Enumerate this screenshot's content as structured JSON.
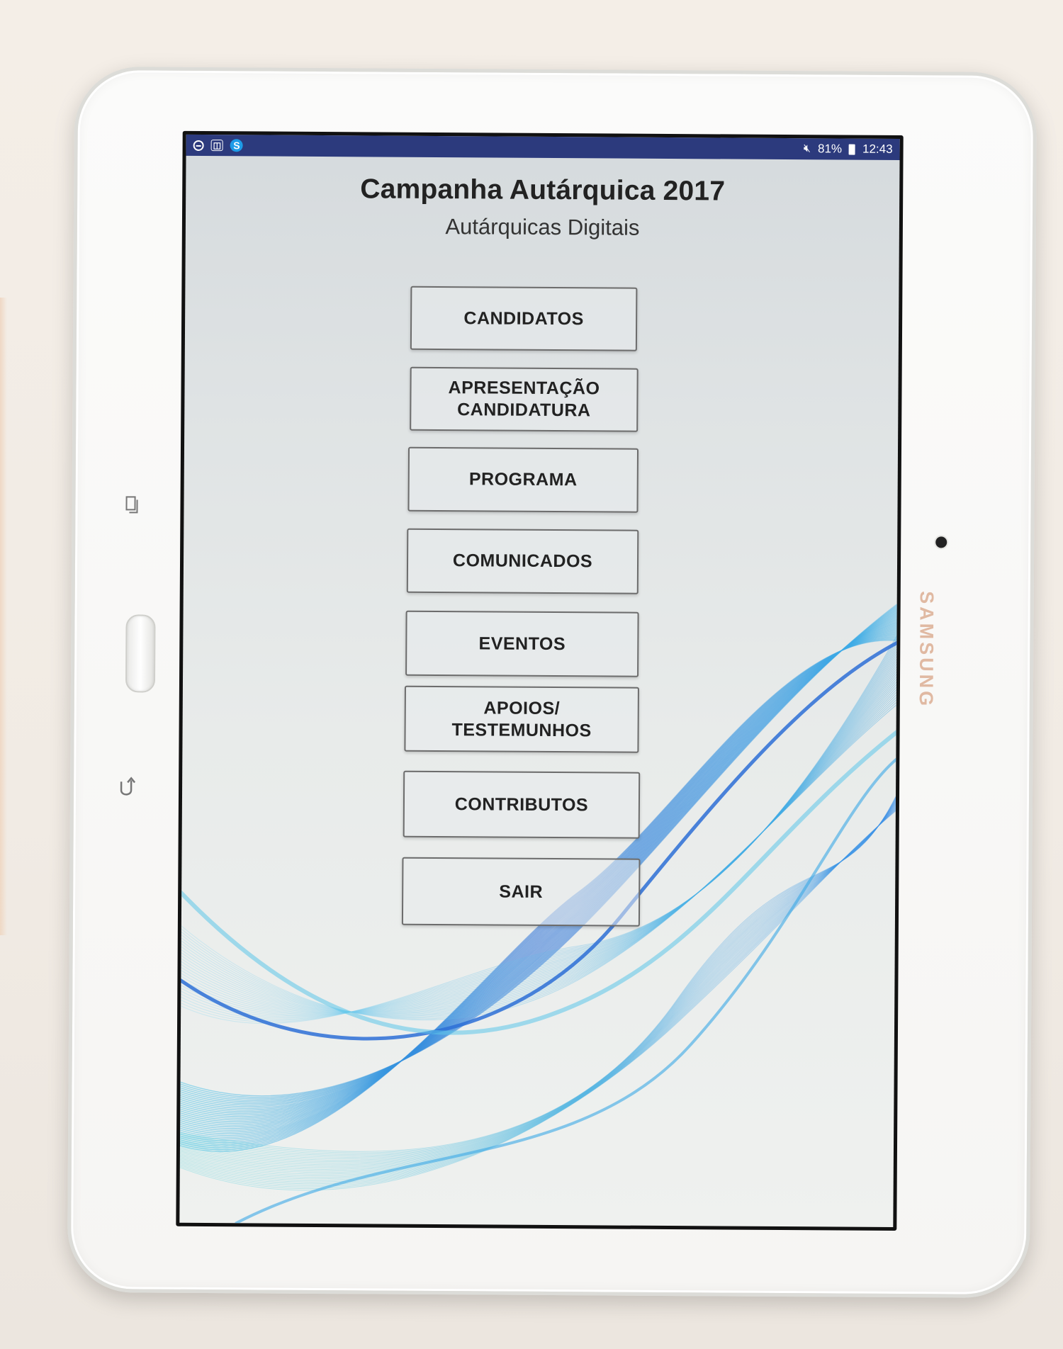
{
  "status_bar": {
    "battery": "81%",
    "time": "12:43",
    "icons": {
      "left": [
        "do-not-disturb-icon",
        "screen-cast-icon",
        "s-app-icon"
      ],
      "right": [
        "mute-icon",
        "battery-icon"
      ]
    }
  },
  "app": {
    "title": "Campanha Autárquica 2017",
    "subtitle": "Autárquicas Digitais",
    "menu": [
      {
        "label": "CANDIDATOS"
      },
      {
        "label": "APRESENTAÇÃO\nCANDIDATURA"
      },
      {
        "label": "PROGRAMA"
      },
      {
        "label": "COMUNICADOS"
      },
      {
        "label": "EVENTOS"
      },
      {
        "label": "APOIOS/\nTESTEMUNHOS"
      },
      {
        "label": "CONTRIBUTOS"
      },
      {
        "label": "SAIR"
      }
    ]
  },
  "device": {
    "brand": "SAMSUNG",
    "nav_keys": [
      "recent-apps-icon",
      "home-button",
      "back-icon"
    ]
  },
  "colors": {
    "status_bar": "#2c3a7d",
    "button_border": "#6c6c6c",
    "wave_dark": "#2f73d8",
    "wave_light": "#3fc4e8",
    "brand_text": "#e0b9a2"
  }
}
